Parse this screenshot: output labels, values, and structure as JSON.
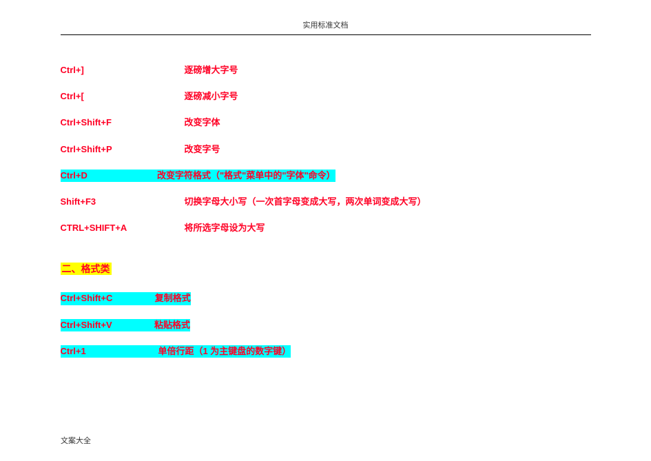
{
  "header": "实用标准文档",
  "rows_a": [
    {
      "key": "Ctrl+]",
      "desc": "逐磅增大字号"
    },
    {
      "key": "Ctrl+[",
      "desc": "逐磅减小字号"
    },
    {
      "key": "Ctrl+Shift+F",
      "desc": "改变字体"
    },
    {
      "key": "Ctrl+Shift+P",
      "desc": "改变字号"
    }
  ],
  "row_hl_a": {
    "key": "Ctrl+D",
    "pad": "                           ",
    "desc": " 改变字符格式（\"格式\"菜单中的\"字体\"命令）"
  },
  "rows_b": [
    {
      "key": "Shift+F3",
      "desc": "切换字母大小写（一次首字母变成大写，两次单词变成大写）"
    },
    {
      "key": "CTRL+SHIFT+A",
      "desc": "   将所选字母设为大写"
    }
  ],
  "section2": "二、格式类",
  "rows_c": [
    {
      "key": "Ctrl+Shift+C",
      "pad": "                ",
      "desc": " 复制格式"
    },
    {
      "key": "Ctrl+Shift+V",
      "pad": "                ",
      "desc": " 粘贴格式"
    },
    {
      "key": "Ctrl+1",
      "pad": "                             ",
      "desc": "单倍行距（1 为主键盘的数字键）"
    }
  ],
  "footer": "文案大全"
}
